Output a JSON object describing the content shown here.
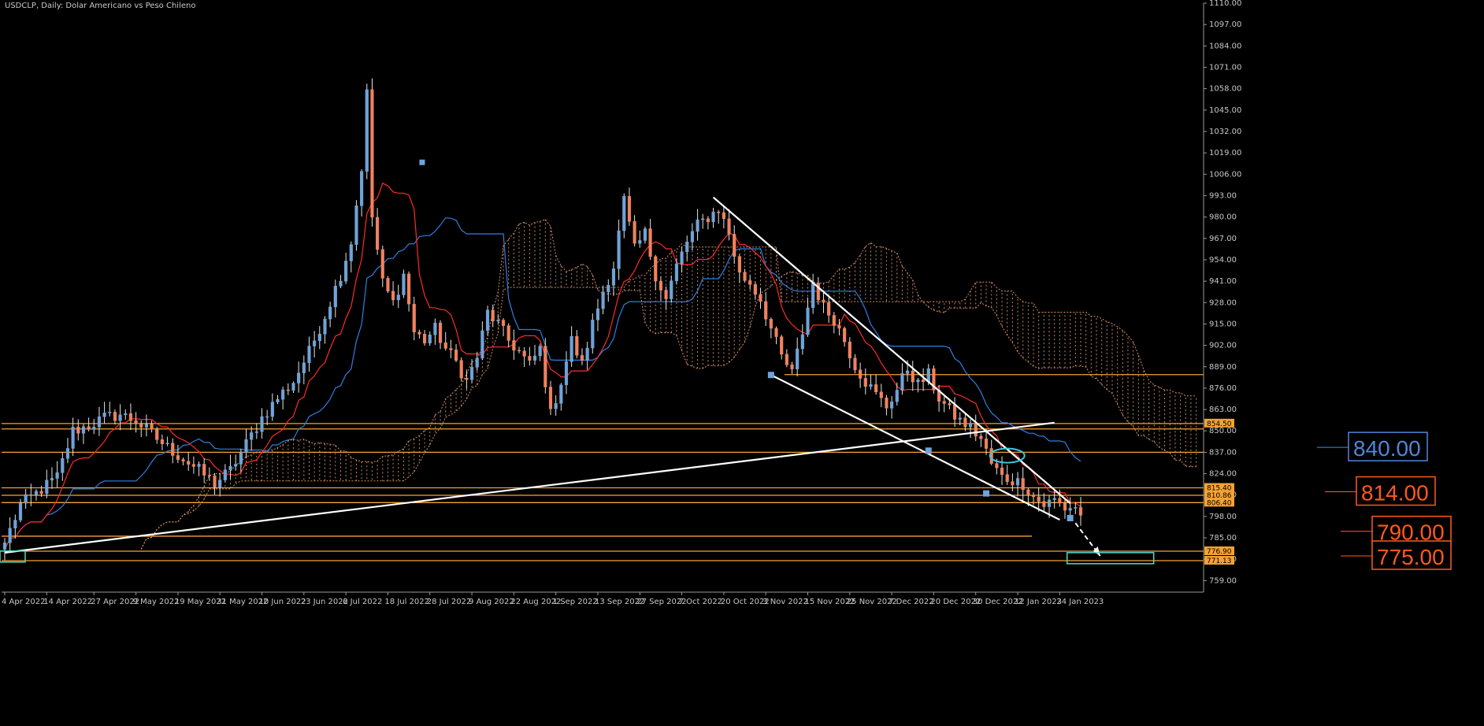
{
  "chart_title": "USDCLP, Daily:  Dolar Americano vs Peso Chileno",
  "colors": {
    "background": "#000000",
    "bull": "#6fa3d9",
    "bear": "#f0825e",
    "tenkan": "#ff2a2a",
    "kijun": "#2f7fe0",
    "cloud": "#e8a070",
    "level": "#f5a233",
    "trend": "#ffffff",
    "label_blue": "#4f86d8",
    "label_orange": "#ff5a1a",
    "axis_text": "#c8c8c8"
  },
  "chart_data": {
    "type": "candlestick",
    "symbol": "USDCLP",
    "timeframe": "Daily",
    "ylim": [
      752,
      1110
    ],
    "y_ticks": [
      "1110.00",
      "1097.00",
      "1084.00",
      "1071.00",
      "1058.00",
      "1045.00",
      "1032.00",
      "1019.00",
      "1006.00",
      "993.00",
      "980.00",
      "967.00",
      "954.00",
      "941.00",
      "928.00",
      "915.00",
      "902.00",
      "889.00",
      "876.00",
      "863.00",
      "850.00",
      "837.00",
      "824.00",
      "811.00",
      "798.00",
      "785.00",
      "772.00",
      "759.00"
    ],
    "x_ticks": [
      {
        "label": "4 Apr 2022",
        "i": 0
      },
      {
        "label": "14 Apr 2022",
        "i": 8
      },
      {
        "label": "27 Apr 2022",
        "i": 17
      },
      {
        "label": "9 May 2022",
        "i": 25
      },
      {
        "label": "19 May 2022",
        "i": 33
      },
      {
        "label": "31 May 2022",
        "i": 41
      },
      {
        "label": "10 Jun 2022",
        "i": 49
      },
      {
        "label": "23 Jun 2022",
        "i": 57
      },
      {
        "label": "6 Jul 2022",
        "i": 65
      },
      {
        "label": "18 Jul 2022",
        "i": 73
      },
      {
        "label": "28 Jul 2022",
        "i": 81
      },
      {
        "label": "9 Aug 2022",
        "i": 89
      },
      {
        "label": "22 Aug 2022",
        "i": 97
      },
      {
        "label": "1 Sep 2022",
        "i": 105
      },
      {
        "label": "13 Sep 2022",
        "i": 113
      },
      {
        "label": "27 Sep 2022",
        "i": 121
      },
      {
        "label": "7 Oct 2022",
        "i": 129
      },
      {
        "label": "20 Oct 2022",
        "i": 137
      },
      {
        "label": "3 Nov 2022",
        "i": 145
      },
      {
        "label": "15 Nov 2022",
        "i": 153
      },
      {
        "label": "25 Nov 2022",
        "i": 161
      },
      {
        "label": "7 Dec 2022",
        "i": 169
      },
      {
        "label": "20 Dec 2022",
        "i": 177
      },
      {
        "label": "30 Dec 2022",
        "i": 185
      },
      {
        "label": "12 Jan 2023",
        "i": 193
      },
      {
        "label": "24 Jan 2023",
        "i": 201
      }
    ],
    "bars_total": 206,
    "close_keypoints": [
      [
        0,
        782
      ],
      [
        3,
        805
      ],
      [
        6,
        812
      ],
      [
        10,
        822
      ],
      [
        13,
        850
      ],
      [
        16,
        853
      ],
      [
        19,
        858
      ],
      [
        22,
        860
      ],
      [
        25,
        856
      ],
      [
        28,
        848
      ],
      [
        31,
        840
      ],
      [
        34,
        833
      ],
      [
        37,
        826
      ],
      [
        40,
        818
      ],
      [
        43,
        826
      ],
      [
        46,
        842
      ],
      [
        49,
        858
      ],
      [
        52,
        870
      ],
      [
        55,
        880
      ],
      [
        58,
        898
      ],
      [
        61,
        920
      ],
      [
        64,
        945
      ],
      [
        66,
        965
      ],
      [
        68,
        1010
      ],
      [
        69,
        1055
      ],
      [
        70,
        980
      ],
      [
        72,
        940
      ],
      [
        74,
        928
      ],
      [
        76,
        945
      ],
      [
        78,
        910
      ],
      [
        80,
        905
      ],
      [
        82,
        912
      ],
      [
        84,
        900
      ],
      [
        86,
        892
      ],
      [
        88,
        880
      ],
      [
        90,
        895
      ],
      [
        92,
        922
      ],
      [
        94,
        915
      ],
      [
        96,
        905
      ],
      [
        98,
        898
      ],
      [
        100,
        890
      ],
      [
        102,
        900
      ],
      [
        104,
        860
      ],
      [
        106,
        880
      ],
      [
        108,
        905
      ],
      [
        110,
        890
      ],
      [
        112,
        915
      ],
      [
        114,
        935
      ],
      [
        116,
        950
      ],
      [
        118,
        990
      ],
      [
        120,
        960
      ],
      [
        122,
        970
      ],
      [
        124,
        945
      ],
      [
        126,
        930
      ],
      [
        128,
        950
      ],
      [
        130,
        965
      ],
      [
        132,
        975
      ],
      [
        134,
        980
      ],
      [
        136,
        985
      ],
      [
        138,
        970
      ],
      [
        140,
        945
      ],
      [
        142,
        940
      ],
      [
        144,
        930
      ],
      [
        146,
        912
      ],
      [
        148,
        895
      ],
      [
        150,
        885
      ],
      [
        152,
        910
      ],
      [
        154,
        940
      ],
      [
        156,
        925
      ],
      [
        158,
        918
      ],
      [
        160,
        905
      ],
      [
        162,
        890
      ],
      [
        164,
        880
      ],
      [
        166,
        872
      ],
      [
        168,
        865
      ],
      [
        170,
        875
      ],
      [
        172,
        888
      ],
      [
        174,
        878
      ],
      [
        176,
        884
      ],
      [
        178,
        870
      ],
      [
        180,
        862
      ],
      [
        182,
        856
      ],
      [
        184,
        852
      ],
      [
        186,
        845
      ],
      [
        188,
        830
      ],
      [
        190,
        822
      ],
      [
        192,
        820
      ],
      [
        194,
        818
      ],
      [
        196,
        810
      ],
      [
        198,
        805
      ],
      [
        200,
        808
      ],
      [
        202,
        803
      ],
      [
        204,
        804
      ],
      [
        205,
        798
      ]
    ],
    "levels": [
      {
        "price": 854.5,
        "label": "854.50"
      },
      {
        "price": 851.2,
        "label": ""
      },
      {
        "price": 837.0,
        "label": ""
      },
      {
        "price": 815.4,
        "label": "815.40"
      },
      {
        "price": 810.86,
        "label": "810.86"
      },
      {
        "price": 806.4,
        "label": "806.40"
      },
      {
        "price": 786.0,
        "label": ""
      },
      {
        "price": 776.9,
        "label": "776.90"
      },
      {
        "price": 771.13,
        "label": "771.13"
      },
      {
        "price": 884.2,
        "label": ""
      }
    ],
    "target_labels": [
      {
        "text": "840.00",
        "price": 840,
        "color": "label_blue"
      },
      {
        "text": "814.00",
        "price": 813,
        "color": "label_orange"
      },
      {
        "text": "790.00",
        "price": 789,
        "color": "label_orange"
      },
      {
        "text": "775.00",
        "price": 774,
        "color": "label_orange"
      }
    ],
    "trendlines": [
      {
        "from": [
          0,
          776
        ],
        "to": [
          200,
          855
        ]
      },
      {
        "from": [
          135,
          992
        ],
        "to": [
          203,
          806
        ]
      },
      {
        "from": [
          146,
          884
        ],
        "to": [
          201,
          796
        ]
      }
    ]
  }
}
